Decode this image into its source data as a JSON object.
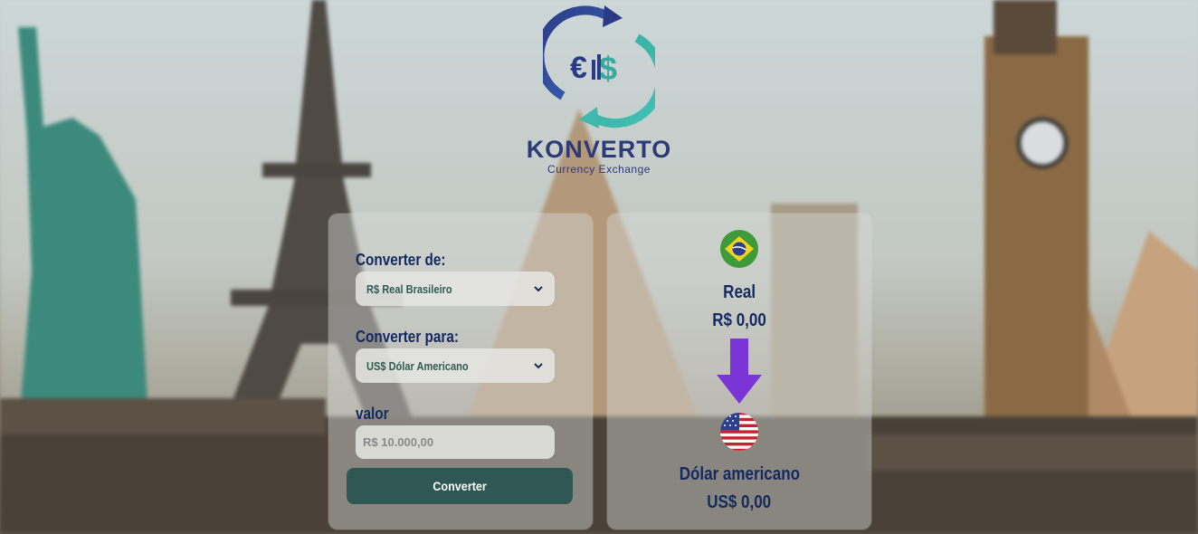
{
  "brand": {
    "name": "KONVERTO",
    "tagline": "Currency Exchange"
  },
  "form": {
    "from_label": "Converter de:",
    "from_value": "R$ Real Brasileiro",
    "to_label": "Converter para:",
    "to_value": "US$ Dólar Americano",
    "amount_label": "valor",
    "amount_placeholder": "R$ 10.000,00",
    "convert_button": "Converter"
  },
  "result": {
    "from_currency": "Real",
    "from_amount": "R$ 0,00",
    "to_currency": "Dólar americano",
    "to_amount": "US$ 0,00"
  },
  "colors": {
    "accent": "#2f5754",
    "text": "#14295f",
    "arrow": "#7b35d6"
  }
}
